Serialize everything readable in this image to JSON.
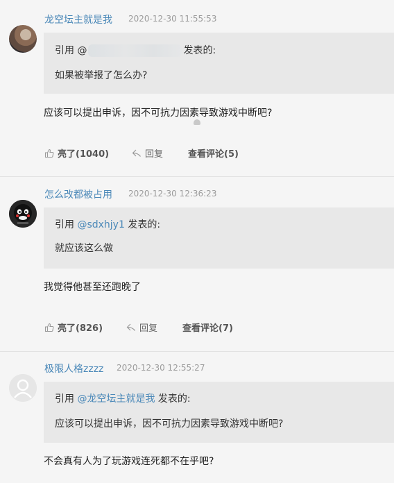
{
  "posts": [
    {
      "username": "龙空坛主就是我",
      "time": "2020-12-30 11:55:53",
      "quote_prefix": "引用 @",
      "quote_suffix": "发表的:",
      "quote_text": "如果被举报了怎么办?",
      "content": "应该可以提出申诉，因不可抗力因素导致游戏中断吧?",
      "like_label": "亮了(1040)",
      "reply_label": "回复",
      "comments_label": "查看评论(5)"
    },
    {
      "username": "怎么改都被占用",
      "time": "2020-12-30 12:36:23",
      "quote_prefix": "引用 ",
      "quote_mention": "@sdxhjy1",
      "quote_suffix": " 发表的:",
      "quote_text": "就应该这么做",
      "content": "我觉得他甚至还跑晚了",
      "like_label": "亮了(826)",
      "reply_label": "回复",
      "comments_label": "查看评论(7)"
    },
    {
      "username": "极限人格zzzz",
      "time": "2020-12-30 12:55:27",
      "quote_prefix": "引用 ",
      "quote_mention": "@龙空坛主就是我",
      "quote_suffix": " 发表的:",
      "quote_text": "应该可以提出申诉，因不可抗力因素导致游戏中断吧?",
      "content": "不会真有人为了玩游戏连死都不在乎吧?"
    }
  ],
  "icons": {
    "like": "thumbs-up-icon",
    "reply": "reply-arrow-icon"
  },
  "colors": {
    "link": "#4a88b8",
    "quote_bg": "#e8e8e8",
    "page_bg": "#f5f5f5"
  }
}
